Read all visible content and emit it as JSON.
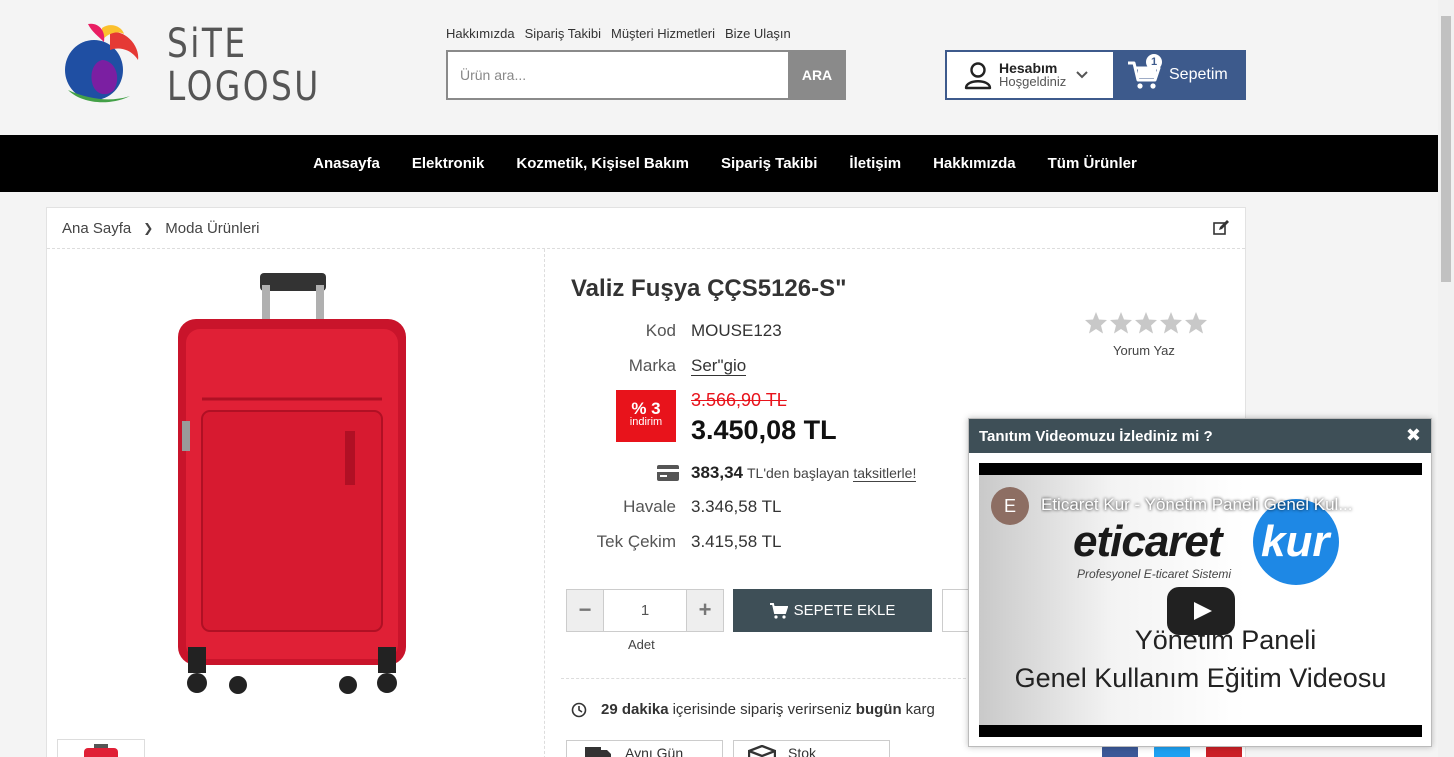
{
  "logo": {
    "line1": "SiTE",
    "line2": "LOGOSU"
  },
  "top_links": [
    "Hakkımızda",
    "Sipariş Takibi",
    "Müşteri Hizmetleri",
    "Bize Ulaşın"
  ],
  "search": {
    "placeholder": "Ürün ara...",
    "button": "ARA"
  },
  "account": {
    "title": "Hesabım",
    "subtitle": "Hoşgeldiniz"
  },
  "cart": {
    "label": "Sepetim",
    "count": "1"
  },
  "nav": [
    "Anasayfa",
    "Elektronik",
    "Kozmetik, Kişisel Bakım",
    "Sipariş Takibi",
    "İletişim",
    "Hakkımızda",
    "Tüm Ürünler"
  ],
  "breadcrumb": {
    "home": "Ana Sayfa",
    "category": "Moda Ürünleri"
  },
  "product": {
    "title": "Valiz Fuşya ÇÇS5126-S\"",
    "code_label": "Kod",
    "code": "MOUSE123",
    "brand_label": "Marka",
    "brand": "Ser\"gio",
    "discount_pct": "% 3",
    "discount_label": "indirim",
    "old_price": "3.566,90 TL",
    "price": "3.450,08 TL",
    "installment_amount": "383,34",
    "installment_text": "TL'den başlayan",
    "installment_link": "taksitlerle!",
    "transfer_label": "Havale",
    "transfer_price": "3.346,58 TL",
    "single_label": "Tek Çekim",
    "single_price": "3.415,58 TL",
    "rating": 0,
    "review_link": "Yorum Yaz"
  },
  "quantity": {
    "value": "1",
    "label": "Adet",
    "minus": "−",
    "plus": "+"
  },
  "add_to_cart": "SEPETE EKLE",
  "delivery": {
    "minutes": "29 dakika",
    "text1": "içerisinde sipariş verirseniz",
    "bold2": "bugün",
    "text2": "karg"
  },
  "chips": [
    "Aynı Gün",
    "Stok"
  ],
  "popup": {
    "title": "Tanıtım Videomuzu İzlediniz mi ?",
    "close": "✖",
    "video": {
      "channel_initial": "E",
      "title": "Eticaret Kur - Yönetim Paneli Genel Kul...",
      "brand_left": "eticaret",
      "brand_right": "kur",
      "tagline": "Profesyonel E-ticaret Sistemi",
      "line1": "Yönetim Paneli",
      "line2": "Genel Kullanım Eğitim Videosu"
    }
  },
  "colors": {
    "brand_blue": "#3d5a8c",
    "nav_bg": "#000000",
    "discount_red": "#e8131b",
    "button_dark": "#3e4f57"
  }
}
